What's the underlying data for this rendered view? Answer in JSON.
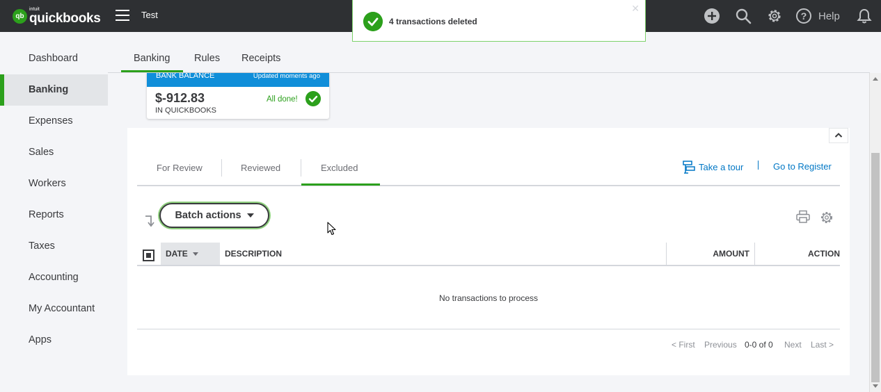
{
  "topbar": {
    "logo_small": "intuit",
    "logo_main": "quickbooks",
    "logo_badge": "qb",
    "company": "Test",
    "help": "Help",
    "icons": [
      "plus-icon",
      "search-icon",
      "gear-icon",
      "help-icon",
      "bell-icon"
    ]
  },
  "toast": {
    "message": "4 transactions deleted",
    "close": "✕"
  },
  "sidebar": {
    "items": [
      {
        "label": "Dashboard"
      },
      {
        "label": "Banking"
      },
      {
        "label": "Expenses"
      },
      {
        "label": "Sales"
      },
      {
        "label": "Workers"
      },
      {
        "label": "Reports"
      },
      {
        "label": "Taxes"
      },
      {
        "label": "Accounting"
      },
      {
        "label": "My Accountant"
      },
      {
        "label": "Apps"
      }
    ],
    "active_index": 1
  },
  "page_tabs": [
    {
      "label": "Banking"
    },
    {
      "label": "Rules"
    },
    {
      "label": "Receipts"
    }
  ],
  "bank_card": {
    "header": "BANK BALANCE",
    "updated": "Updated moments ago",
    "amount": "$-912.83",
    "caption": "IN QUICKBOOKS",
    "status": "All done!"
  },
  "sub_tabs": [
    {
      "label": "For Review"
    },
    {
      "label": "Reviewed"
    },
    {
      "label": "Excluded"
    }
  ],
  "links": {
    "tour": "Take a tour",
    "register": "Go to Register"
  },
  "toolbar": {
    "batch_label": "Batch actions"
  },
  "table": {
    "columns": [
      "DATE",
      "DESCRIPTION",
      "AMOUNT",
      "ACTION"
    ],
    "empty_message": "No transactions to process"
  },
  "pager": {
    "first": "< First",
    "previous": "Previous",
    "count": "0-0 of 0",
    "next": "Next",
    "last": "Last >"
  },
  "colors": {
    "brand_green": "#2ca01c",
    "topbar": "#2e3033",
    "link_blue": "#0077c5",
    "card_blue": "#108ed9"
  }
}
